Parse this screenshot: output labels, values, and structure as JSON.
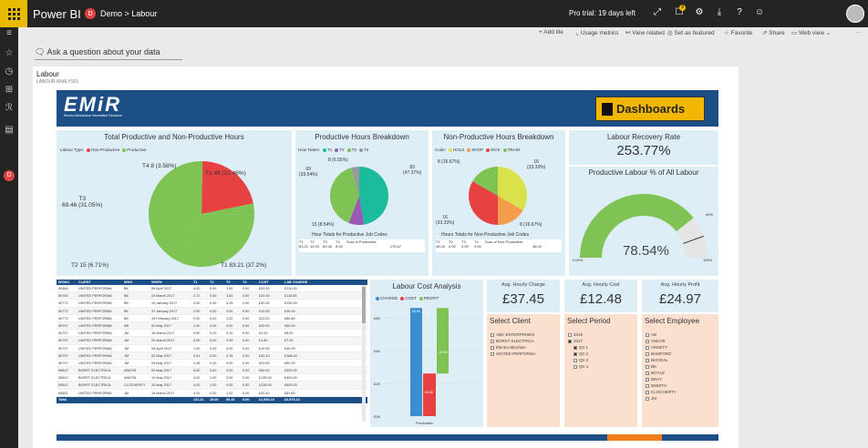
{
  "top": {
    "brand": "Power BI",
    "workspace_badge": "D",
    "breadcrumb": "Demo > Labour",
    "trial": "Pro trial: 19 days left",
    "notif_count": "9"
  },
  "actions": {
    "add_tile": "+ Add tile",
    "usage": "Usage metrics",
    "related": "View related",
    "featured": "Set as featured",
    "favorite": "Favorite",
    "share": "Share",
    "web_view": "Web view"
  },
  "qna": "Ask a question about your data",
  "page": {
    "title": "Labour",
    "subtitle": "LABOUR ANALYSIS"
  },
  "banner": {
    "logo": "EMiR",
    "logo_sub": "Electro-Mechanical Information Resource",
    "dashboards": "Dashboards"
  },
  "pie1": {
    "title": "Total Productive and Non-Productive Hours",
    "legend_title": "Labour Type",
    "legend": [
      "Non-Productive",
      "Productive"
    ],
    "labels": [
      "T4 8 (3.58%)",
      "T1 48 (21.46%)",
      "T3\n69.46 (31.05%)",
      "T2 15 (6.71%)",
      "T1 83.21 (37.2%)"
    ]
  },
  "pie2": {
    "title": "Productive Hours Breakdown",
    "legend_title": "Hour Rates",
    "legend": [
      "T1",
      "T2",
      "T3",
      "T4"
    ],
    "labels": [
      "8 (6.55%)",
      "69\n(39.54%)",
      "83\n(47.37%)",
      "15 (8.54%)"
    ],
    "sub_title": "Hour Totals for Productive Job Codes",
    "headers": [
      "T1",
      "T2",
      "T3",
      "T4",
      "Sum of Productive"
    ],
    "values": [
      "83.21",
      "15.00",
      "69.46",
      "8.00",
      "175.67"
    ]
  },
  "pie3": {
    "title": "Non-Productive Hours Breakdown",
    "legend_title": "Code",
    "legend": [
      "HOLS",
      "SHOP",
      "SICK",
      "TRAIN"
    ],
    "labels": [
      "8 (16.67%)",
      "16\n(33.33%)",
      "16\n(33.33%)",
      "8 (16.67%)"
    ],
    "sub_title": "Hours Totals for Non-Productive Job Codes",
    "headers": [
      "T1",
      "T2",
      "T3",
      "T4",
      "Sum of Non-Productive"
    ],
    "values": [
      "48.00",
      "0.00",
      "0.00",
      "0.00",
      "48.00"
    ]
  },
  "recovery": {
    "title": "Labour Recovery Rate",
    "value": "253.77%"
  },
  "gauge": {
    "title": "Productive Labour % of All Labour",
    "value": "78.54%",
    "min": "0.00%",
    "max": "100%",
    "target": "89%",
    "fraction": 0.7854,
    "target_fraction": 0.89
  },
  "table": {
    "headers": [
      "WONO",
      "CLIENT",
      "WHO",
      "WHEN",
      "T1",
      "T2",
      "T3",
      "T4",
      "COST",
      "LAB CHARGE"
    ],
    "rows": [
      [
        "50468",
        "UNITED PERFORMA",
        "BK",
        "06 April 2017",
        "4.00",
        "0.00",
        "1.00",
        "0.00",
        "£52.50",
        "£210.00"
      ],
      [
        "50750",
        "UNITED PERFORMA",
        "BK",
        "24 March 2017",
        "2.17",
        "0.00",
        "1.83",
        "0.00",
        "£29.15",
        "£115.83"
      ],
      [
        "50772",
        "UNITED PERFORMA",
        "BK",
        "19 January 2017",
        "0.00",
        "0.00",
        "3.25",
        "0.00",
        "£32.50",
        "£130.00"
      ],
      [
        "50772",
        "UNITED PERFORMA",
        "BK",
        "31 January 2017",
        "2.00",
        "0.00",
        "0.00",
        "0.00",
        "£10.00",
        "£40.00"
      ],
      [
        "50772",
        "UNITED PERFORMA",
        "BK",
        "15 February 2017",
        "0.00",
        "0.00",
        "2.02",
        "0.00",
        "£20.20",
        "£80.80"
      ],
      [
        "50797",
        "UNITED PERFORMA",
        "AB",
        "02 May 2017",
        "2.00",
        "0.00",
        "0.00",
        "0.00",
        "£20.00",
        "£80.00"
      ],
      [
        "50797",
        "UNITED PERFORMA",
        "JM",
        "16 March 2017",
        "0.00",
        "0.00",
        "0.10",
        "0.00",
        "£2.00",
        "£8.00"
      ],
      [
        "50797",
        "UNITED PERFORMA",
        "JM",
        "20 March 2017",
        "0.00",
        "0.00",
        "0.09",
        "0.00",
        "£1.80",
        "£7.20"
      ],
      [
        "50797",
        "UNITED PERFORMA",
        "JM",
        "28 April 2017",
        "1.00",
        "0.00",
        "0.00",
        "0.00",
        "£10.00",
        "£40.00"
      ],
      [
        "50797",
        "UNITED PERFORMA",
        "JM",
        "02 May 2017",
        "3.91",
        "0.00",
        "0.15",
        "0.00",
        "£42.10",
        "£168.40"
      ],
      [
        "50797",
        "UNITED PERFORMA",
        "JM",
        "09 May 2017",
        "2.06",
        "0.00",
        "0.00",
        "0.00",
        "£20.60",
        "£82.00"
      ],
      [
        "50812",
        "BORST ELECTRICA",
        "ANDYB",
        "09 May 2017",
        "8.00",
        "0.00",
        "0.00",
        "0.00",
        "£80.00",
        "£320.00"
      ],
      [
        "50812",
        "BORST ELECTRICA",
        "ANDYB",
        "10 May 2017",
        "4.00",
        "1.00",
        "0.00",
        "0.00",
        "£135.00",
        "£400.00"
      ],
      [
        "50812",
        "BORST ELECTRICA",
        "CLOCHERTY",
        "10 May 2017",
        "4.00",
        "1.00",
        "0.00",
        "0.00",
        "£135.00",
        "£500.00"
      ],
      [
        "50851",
        "UNITED PERFORMA",
        "JM",
        "19 March 2017",
        "0.00",
        "0.00",
        "1.02",
        "0.00",
        "£20.40",
        "£81.60"
      ]
    ],
    "total": [
      "Total",
      "",
      "",
      "",
      "131.21",
      "15.00",
      "69.46",
      "8.00",
      "£2,592.10",
      "£6,578.10"
    ]
  },
  "labour_cost": {
    "title": "Labour Cost Analysis",
    "legend": [
      "CHARGE",
      "COST",
      "PROFIT"
    ],
    "yticks": [
      "£6K",
      "£4K",
      "£2K",
      "£0K"
    ],
    "xlabel": "Productive",
    "data_labels": [
      "£6.6K",
      "£4.0K",
      "£2.6K"
    ]
  },
  "chart_data": {
    "type": "bar",
    "title": "Labour Cost Analysis",
    "categories": [
      "Productive"
    ],
    "series": [
      {
        "name": "CHARGE",
        "values": [
          6.6
        ]
      },
      {
        "name": "COST",
        "values": [
          2.6
        ]
      },
      {
        "name": "PROFIT",
        "values": [
          4.0
        ]
      }
    ],
    "ylabel": "",
    "ylim": [
      0,
      7
    ],
    "legend": "top-left"
  },
  "kpis": [
    {
      "title": "Avg. Hourly Charge",
      "value": "£37.45"
    },
    {
      "title": "Avg. Hourly Cost",
      "value": "£12.48"
    },
    {
      "title": "Avg. Hourly Profit",
      "value": "£24.97"
    }
  ],
  "slicers": {
    "client": {
      "title": "Select Client",
      "items": [
        "ABC ENTERPRISES",
        "BORST ELECTRICA",
        "Electro-Mechani",
        "UNITED PERFORMA"
      ]
    },
    "period": {
      "title": "Select Period",
      "items": [
        "2016",
        "2017",
        "Qtr 1",
        "Qtr 2",
        "Qtr 3",
        "Qtr 4"
      ]
    },
    "employee": {
      "title": "Select Employee",
      "items": [
        "AB",
        "ANDYB",
        "ARNETT",
        "BAMFORD",
        "BHOGAL",
        "BK",
        "BOYLE",
        "BRAY",
        "BSMITH",
        "CLOCHERTY",
        "JM"
      ]
    }
  },
  "colors": {
    "red": "#e84142",
    "green": "#7ec353",
    "teal": "#1abc9c",
    "purple": "#9b59b6",
    "yellow": "#d9e24b",
    "orange": "#f39c4b",
    "navy": "#1b4f86",
    "blue": "#3b8ed0"
  }
}
